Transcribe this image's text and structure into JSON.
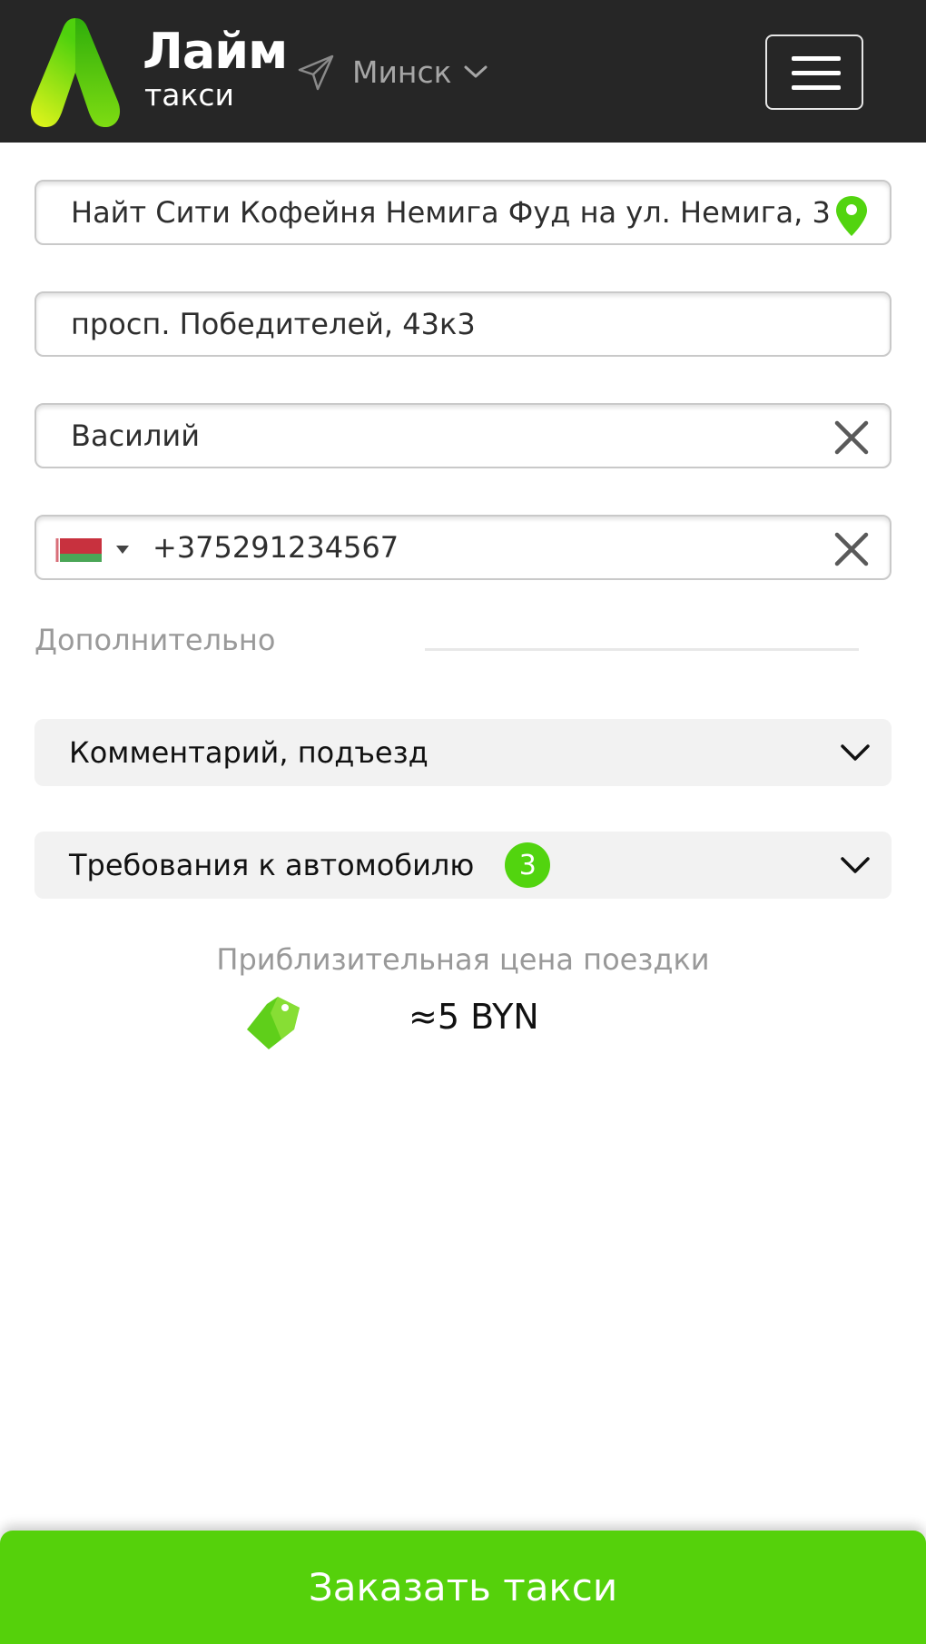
{
  "header": {
    "brand_name": "Лайм",
    "brand_sub": "такси",
    "city": "Минск",
    "icons": {
      "logo": "lime-logo",
      "plane": "paper-plane-icon",
      "city_chevron": "chevron-down-icon",
      "menu": "hamburger-menu-icon"
    }
  },
  "form": {
    "from_address": "Найт Сити Кофейня Немига Фуд на ул. Немига, 3",
    "to_address": "просп. Победителей, 43к3",
    "name": "Василий",
    "phone": "+375291234567",
    "country_flag": "by-flag",
    "icons": {
      "from": "map-pin-icon",
      "name_clear": "close-icon",
      "phone_clear": "close-icon"
    }
  },
  "extra": {
    "section_label": "Дополнительно",
    "comment_label": "Комментарий, подъезд",
    "car_requirements_label": "Требования к автомобилю",
    "car_requirements_count": "3"
  },
  "price": {
    "caption": "Приблизительная цена поездки",
    "value": "≈5 BYN",
    "icon": "price-tag-icon"
  },
  "order_button_label": "Заказать такси",
  "colors": {
    "header_bg": "#262626",
    "accent_green": "#55d10b",
    "badge_green": "#52d40f",
    "accordion_bg": "#f2f2f2"
  }
}
